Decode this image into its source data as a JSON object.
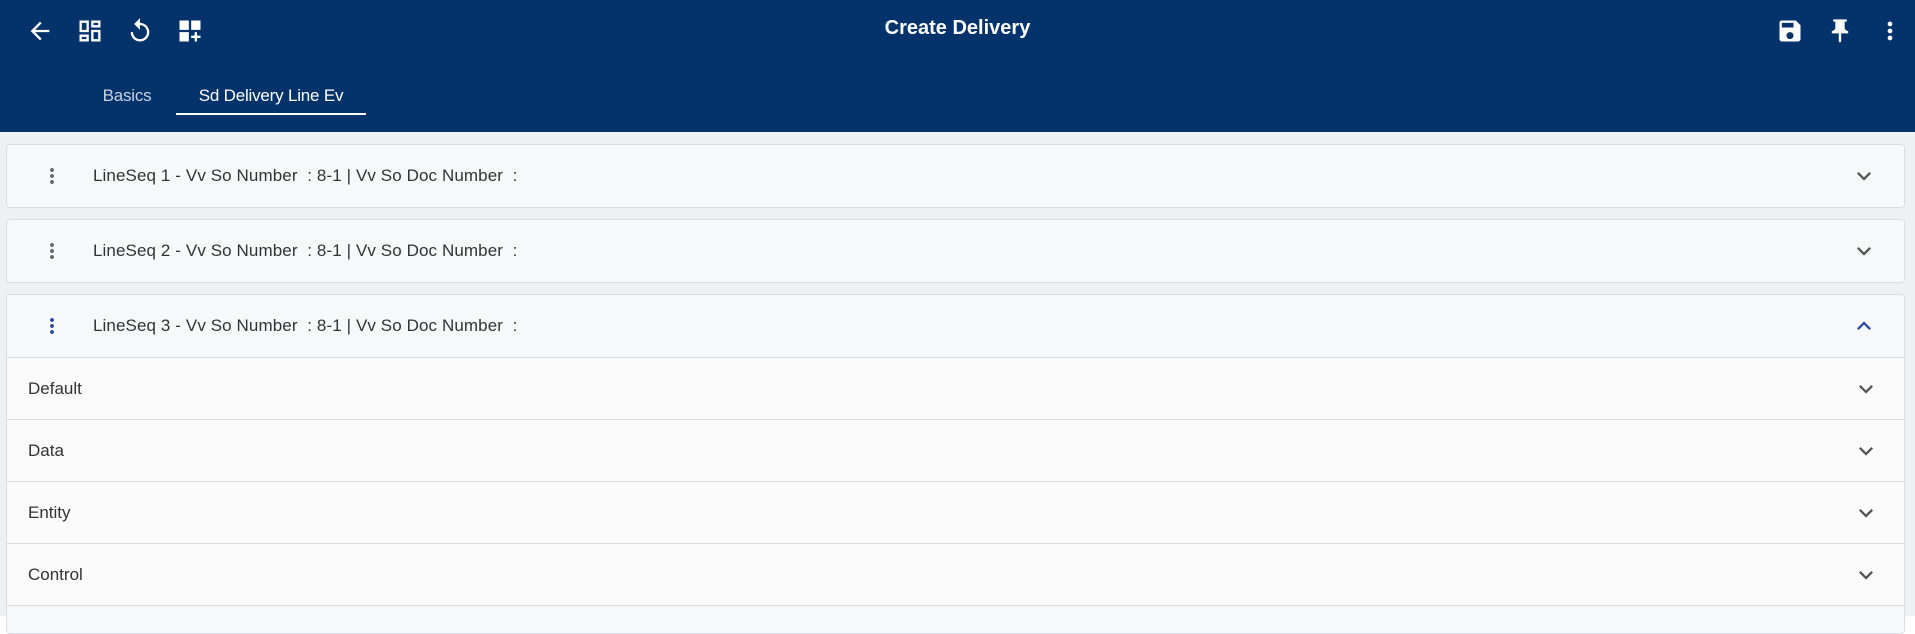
{
  "header": {
    "title": "Create Delivery",
    "left_icons": [
      "back-arrow-icon",
      "dashboard-icon",
      "refresh-icon",
      "add-widget-icon"
    ],
    "right_icons": [
      "save-icon",
      "pin-icon",
      "more-vert-icon"
    ],
    "bg_color": "#04326b"
  },
  "tabs": [
    {
      "label": "Basics",
      "active": false
    },
    {
      "label": "Sd Delivery Line Ev",
      "active": true
    }
  ],
  "panels": [
    {
      "title": "LineSeq 1 - Vv So Number  : 8-1 | Vv So Doc Number  :",
      "expanded": false
    },
    {
      "title": "LineSeq 2 - Vv So Number  : 8-1 | Vv So Doc Number  :",
      "expanded": false
    },
    {
      "title": "LineSeq 3 - Vv So Number  : 8-1 | Vv So Doc Number  :",
      "expanded": true,
      "sections": [
        "Default",
        "Data",
        "Entity",
        "Control"
      ]
    }
  ],
  "colors": {
    "accent": "#2f4a9e",
    "panel_bg": "#f7f8fa"
  }
}
